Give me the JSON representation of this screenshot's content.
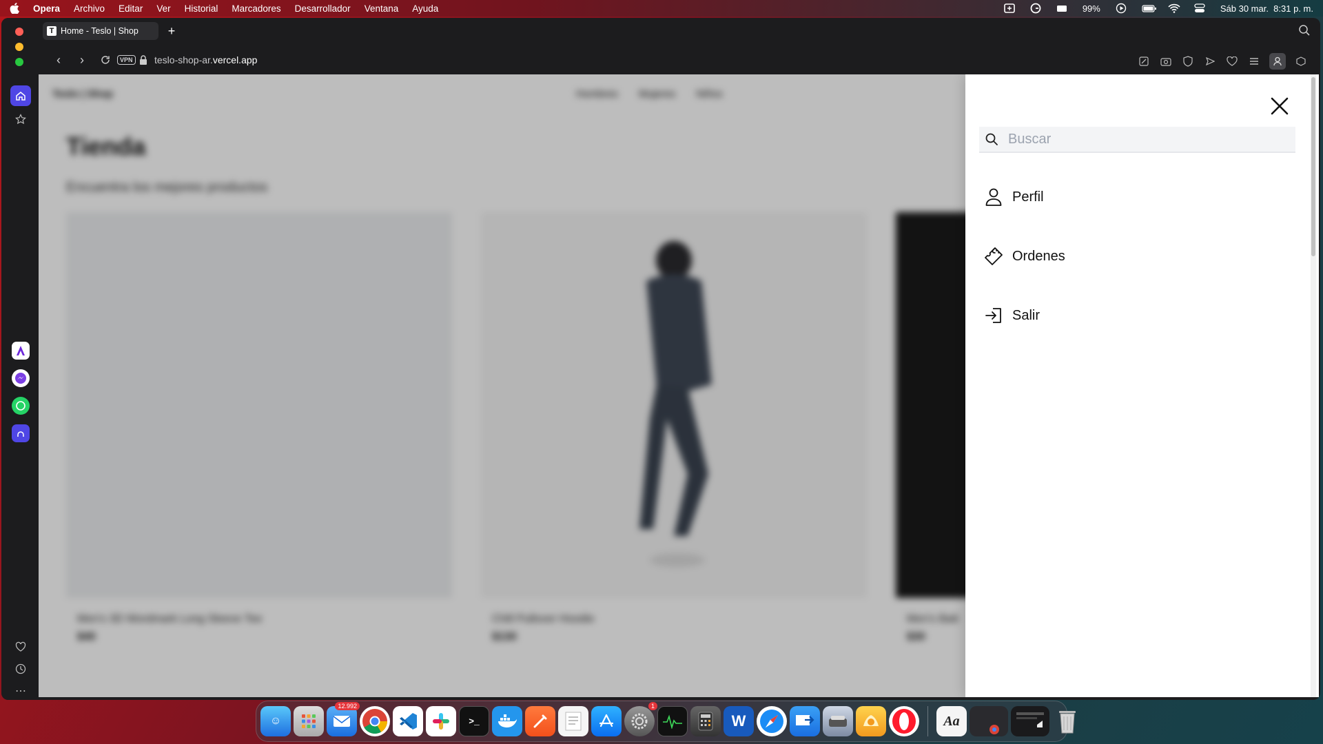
{
  "menubar": {
    "app": "Opera",
    "menus": [
      "Archivo",
      "Editar",
      "Ver",
      "Historial",
      "Marcadores",
      "Desarrollador",
      "Ventana",
      "Ayuda"
    ],
    "battery": "99%",
    "datetime": "Sáb 30 mar.  8:31 p. m."
  },
  "browser": {
    "tab_title": "Home - Teslo | Shop",
    "favicon_letter": "T",
    "vpn_label": "VPN",
    "url_prefix": "teslo-shop-ar.",
    "url_domain": "vercel.app"
  },
  "page": {
    "logo": "Teslo | Shop",
    "nav": [
      "Hombres",
      "Mujeres",
      "Niños"
    ],
    "title": "Tienda",
    "subtitle": "Encuentra los mejores productos",
    "products": [
      {
        "name": "Men's 3D Wordmark Long Sleeve Tee",
        "price": "$40"
      },
      {
        "name": "Chill Pullover Hoodie",
        "price": "$130"
      },
      {
        "name": "Men's Batt",
        "price": "$30"
      }
    ]
  },
  "side_menu": {
    "search_placeholder": "Buscar",
    "items": [
      {
        "label": "Perfil",
        "icon": "person-icon"
      },
      {
        "label": "Ordenes",
        "icon": "ticket-icon"
      },
      {
        "label": "Salir",
        "icon": "logout-icon"
      }
    ]
  },
  "dock": {
    "mail_badge": "12.992",
    "settings_badge": "1"
  }
}
